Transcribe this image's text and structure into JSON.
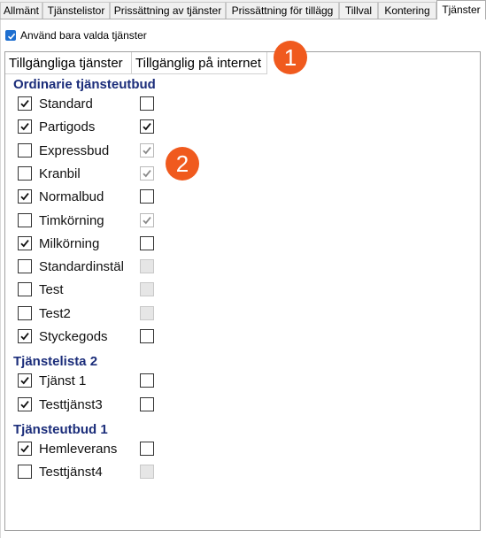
{
  "tabs": [
    {
      "label": "Allmänt"
    },
    {
      "label": "Tjänstelistor"
    },
    {
      "label": "Prissättning av tjänster"
    },
    {
      "label": "Prissättning för tillägg"
    },
    {
      "label": "Tillval"
    },
    {
      "label": "Kontering"
    },
    {
      "label": "Tjänster"
    }
  ],
  "active_tab": "Tjänster",
  "use_selected": {
    "label": "Använd bara valda tjänster",
    "checked": true
  },
  "columns": [
    {
      "label": "Tillgängliga tjänster"
    },
    {
      "label": "Tillgänglig på internet"
    }
  ],
  "badges": [
    "1",
    "2"
  ],
  "groups": [
    {
      "title": "Ordinarie tjänsteutbud",
      "items": [
        {
          "label": "Standard",
          "available": true,
          "internet": "unchecked"
        },
        {
          "label": "Partigods",
          "available": true,
          "internet": "checked"
        },
        {
          "label": "Expressbud",
          "available": false,
          "internet": "checked-disabled"
        },
        {
          "label": "Kranbil",
          "available": false,
          "internet": "checked-disabled"
        },
        {
          "label": "Normalbud",
          "available": true,
          "internet": "unchecked"
        },
        {
          "label": "Timkörning",
          "available": false,
          "internet": "checked-disabled"
        },
        {
          "label": "Milkörning",
          "available": true,
          "internet": "unchecked"
        },
        {
          "label": "Standardinstäl",
          "available": false,
          "internet": "disabled"
        },
        {
          "label": "Test",
          "available": false,
          "internet": "disabled"
        },
        {
          "label": "Test2",
          "available": false,
          "internet": "disabled"
        },
        {
          "label": "Styckegods",
          "available": true,
          "internet": "unchecked"
        }
      ]
    },
    {
      "title": "Tjänstelista 2",
      "items": [
        {
          "label": "Tjänst 1",
          "available": true,
          "internet": "unchecked"
        },
        {
          "label": "Testtjänst3",
          "available": true,
          "internet": "unchecked"
        }
      ]
    },
    {
      "title": "Tjänsteutbud 1",
      "items": [
        {
          "label": "Hemleverans",
          "available": true,
          "internet": "unchecked"
        },
        {
          "label": "Testtjänst4",
          "available": false,
          "internet": "disabled"
        }
      ]
    }
  ],
  "colors": {
    "accent": "#1e6fd0",
    "section": "#1b2d7a",
    "badge": "#f05a1e"
  }
}
